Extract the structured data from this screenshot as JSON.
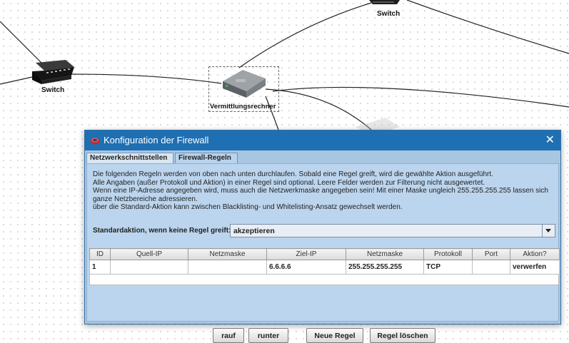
{
  "network": {
    "nodes": [
      {
        "label": "Switch"
      },
      {
        "label": "Switch"
      },
      {
        "label": "Vermittlungsrechner"
      }
    ]
  },
  "dialog": {
    "title": "Konfiguration der Firewall",
    "close_symbol": "✕",
    "tabs": [
      {
        "label": "Netzwerkschnittstellen",
        "active": false
      },
      {
        "label": "Firewall-Regeln",
        "active": true
      }
    ],
    "description_lines": [
      "Die folgenden Regeln werden von oben nach unten durchlaufen. Sobald eine Regel greift, wird die gewählte Aktion ausgeführt.",
      "Alle Angaben (außer Protokoll und Aktion) in einer Regel sind optional. Leere Felder werden zur Filterung nicht ausgewertet.",
      "Wenn eine IP-Adresse angegeben wird, muss auch die Netzwerkmaske angegeben sein! Mit einer Maske ungleich 255.255.255.255 lassen sich",
      "ganze Netzbereiche adressieren.",
      "über die Standard-Aktion kann zwischen Blacklisting- und Whitelisting-Ansatz gewechselt werden."
    ],
    "default_action_label": "Standardaktion, wenn keine Regel greift:",
    "default_action_value": "akzeptieren",
    "table": {
      "headers": [
        "ID",
        "Quell-IP",
        "Netzmaske",
        "Ziel-IP",
        "Netzmaske",
        "Protokoll",
        "Port",
        "Aktion?"
      ],
      "rows": [
        [
          "1",
          "",
          "",
          "6.6.6.6",
          "255.255.255.255",
          "TCP",
          "",
          "verwerfen"
        ]
      ]
    },
    "buttons": {
      "up": "rauf",
      "down": "runter",
      "new_rule": "Neue Regel",
      "delete_rule": "Regel löschen"
    },
    "colors": {
      "titlebar": "#1f6fb3",
      "panel": "#bcd5ee"
    }
  }
}
